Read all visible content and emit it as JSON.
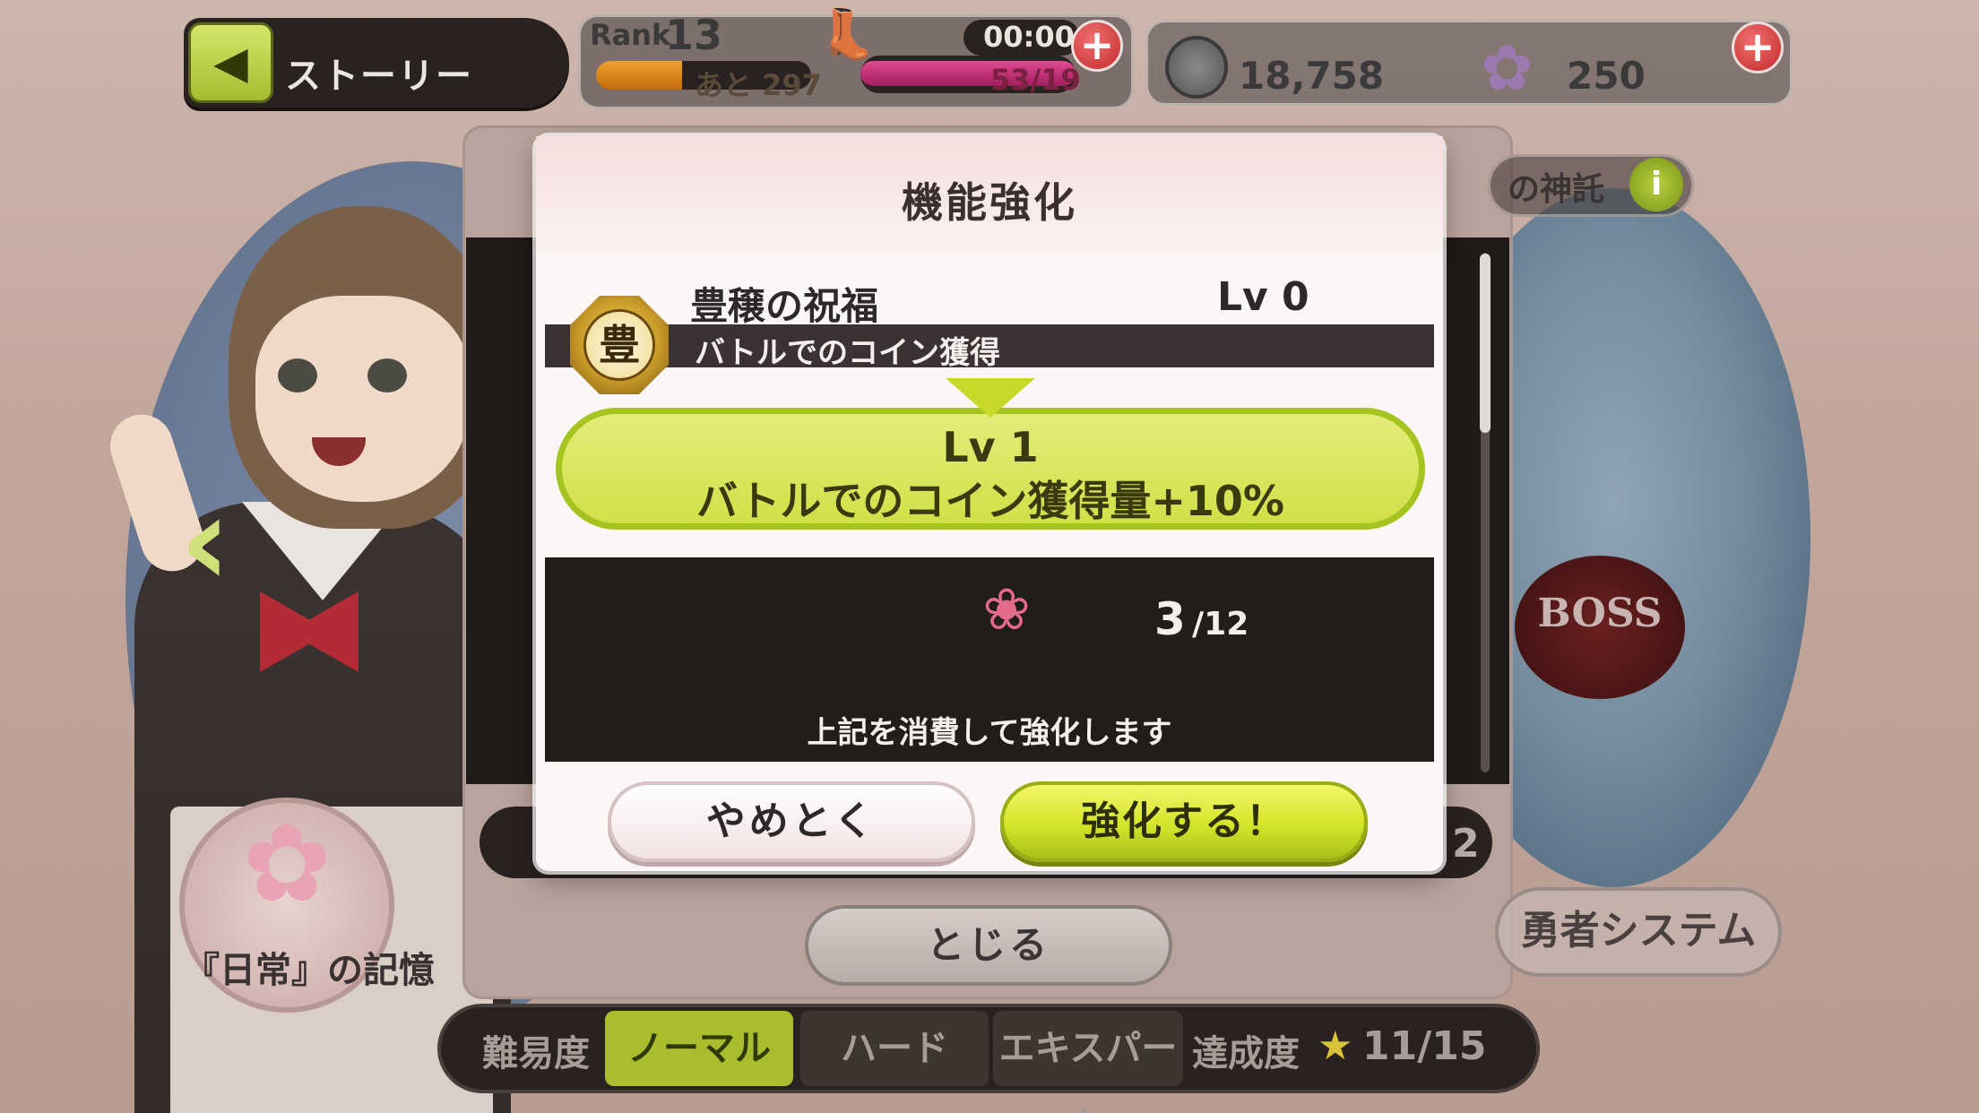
{
  "hud": {
    "back_label": "ストーリー",
    "rank_label": "Rank",
    "rank_value": "13",
    "exp_text": "あと 297",
    "exp_progress": 0.4,
    "timer": "00:00",
    "stamina_text": "53/19",
    "stamina_progress": 1.0,
    "coins": "18,758",
    "flowers": "250"
  },
  "background": {
    "info_text": "の神託",
    "boss_label": "BOSS",
    "close_button": "とじる",
    "yusha_button": "勇者システム",
    "memory_label": "『日常』の記憶",
    "row_count": "2",
    "difficulty": {
      "label": "難易度",
      "tabs": [
        {
          "label": "ノーマル",
          "active": true
        },
        {
          "label": "ハード",
          "active": false
        },
        {
          "label": "エキスパート",
          "active": false
        }
      ],
      "progress_label": "達成度",
      "progress_value": "11/15"
    }
  },
  "modal": {
    "title": "機能強化",
    "skill": {
      "badge_char": "豊",
      "name": "豊穣の祝福",
      "level": "Lv 0",
      "description": "バトルでのコイン獲得"
    },
    "upgrade": {
      "level": "Lv 1",
      "effect": "バトルでのコイン獲得量+10%"
    },
    "cost": {
      "have": "3",
      "need": "/12",
      "note": "上記を消費して強化します"
    },
    "cancel_button": "やめとく",
    "confirm_button": "強化する！"
  },
  "colors": {
    "accent_green": "#a6c420",
    "modal_bg": "#fdf6f6",
    "dark_panel": "#221c1b"
  },
  "icons": {
    "back": "left-arrow-icon",
    "coin": "coin-icon",
    "flower": "flower-icon",
    "boot": "boot-icon",
    "cost": "flower-icon",
    "star": "star-icon"
  }
}
